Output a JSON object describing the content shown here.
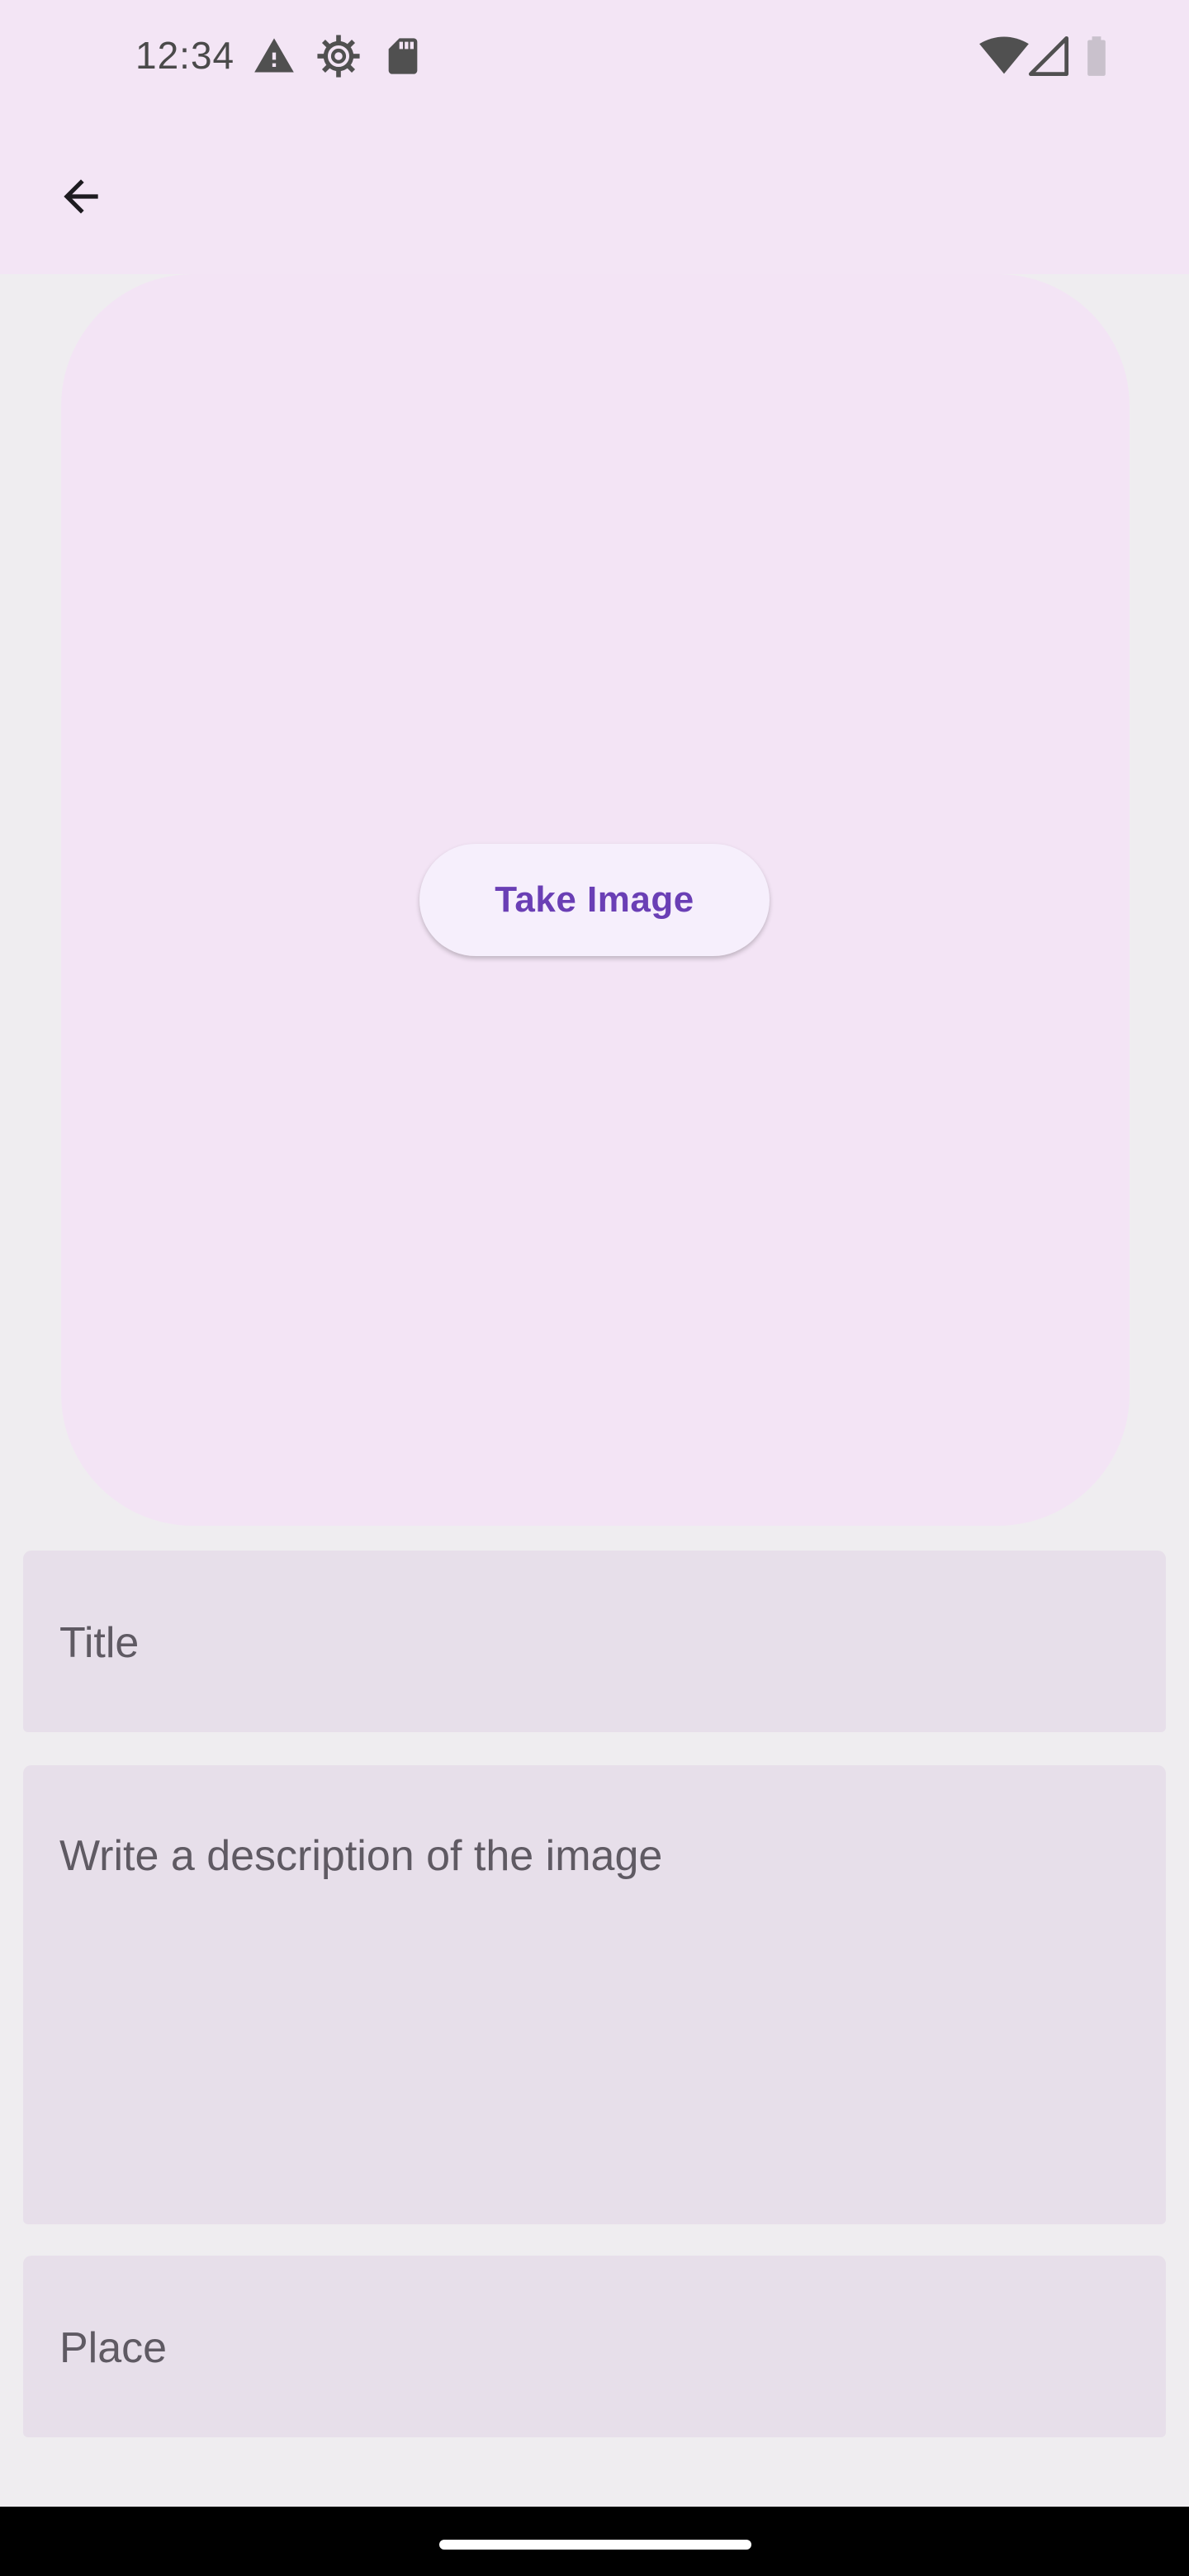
{
  "status_bar": {
    "time": "12:34",
    "icons": [
      "warning-icon",
      "settings-gear-icon",
      "sd-card-icon",
      "wifi-icon",
      "cell-signal-icon",
      "battery-icon"
    ]
  },
  "app_bar": {
    "back_icon": "arrow-back-icon"
  },
  "image_area": {
    "take_image_label": "Take Image"
  },
  "form": {
    "title_placeholder": "Title",
    "description_placeholder": "Write a description of the image",
    "place_placeholder": "Place"
  },
  "colors": {
    "app_bar_bg": "#f3e5f5",
    "accent": "#6a3fb5",
    "field_bg": "#e7dfea",
    "page_bg": "#efedf0"
  }
}
